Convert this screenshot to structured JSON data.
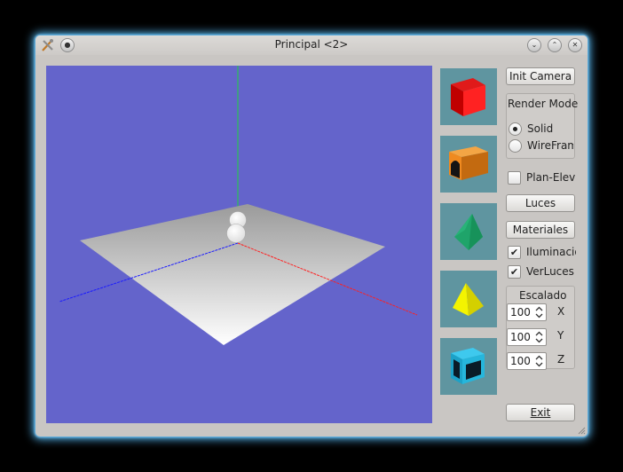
{
  "window": {
    "title": "Principal <2>"
  },
  "controls": {
    "init_camera": "Init Camera",
    "render_mode": {
      "title": "Render Mode",
      "options": [
        "Solid",
        "WireFrame"
      ],
      "selected": "Solid"
    },
    "plan_elev": {
      "label": "Plan-Elev",
      "checked": false
    },
    "luces": "Luces",
    "materiales": "Materiales",
    "iluminacion": {
      "label": "Iluminacio",
      "checked": true
    },
    "ver_luces": {
      "label": "VerLuces",
      "checked": true
    },
    "escalado": {
      "title": "Escalado",
      "x": {
        "value": "100",
        "axis": "X"
      },
      "y": {
        "value": "100",
        "axis": "Y"
      },
      "z": {
        "value": "100",
        "axis": "Z"
      }
    },
    "exit": "Exit"
  },
  "shapes": [
    "red-cube",
    "orange-arch",
    "green-polyhedron",
    "yellow-pyramid",
    "cyan-hollow-cube"
  ],
  "colors": {
    "viewport_bg": "#6464cb",
    "thumb_bg": "#5f95a0",
    "axis_x": "#ff2020",
    "axis_y": "#20d040",
    "axis_z": "#1a1aff",
    "glow": "#58b8f0"
  }
}
